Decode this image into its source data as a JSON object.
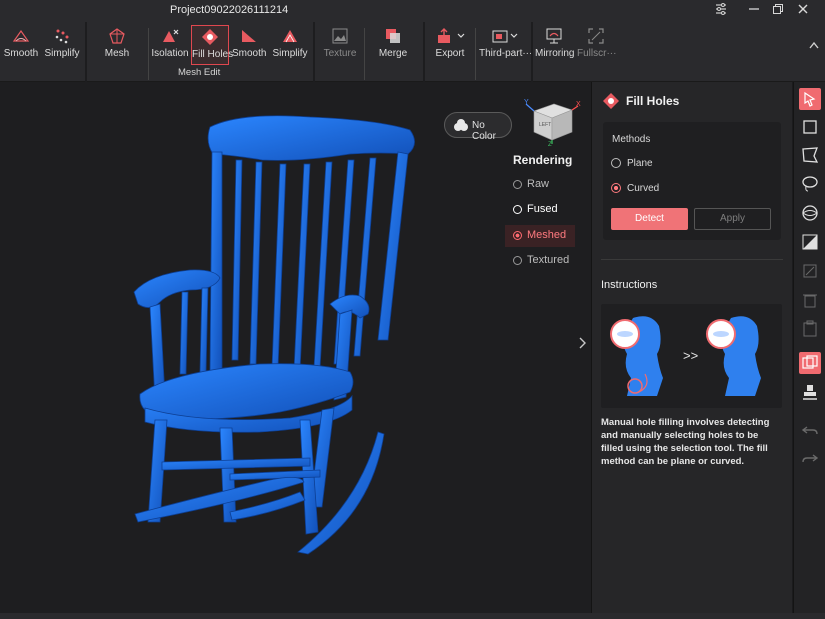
{
  "window": {
    "title": "Project09022026111214",
    "controls": [
      "settings-icon",
      "minimize-icon",
      "restore-icon",
      "close-icon"
    ]
  },
  "toolbar": {
    "tools": [
      {
        "id": "smooth-left",
        "label": "Smooth",
        "icon": "smooth-icon"
      },
      {
        "id": "simplify-left",
        "label": "Simplify",
        "icon": "simplify-icon"
      },
      {
        "id": "mesh",
        "label": "Mesh",
        "icon": "mesh-icon"
      },
      {
        "id": "isolation",
        "label": "Isolation",
        "icon": "isolation-icon"
      },
      {
        "id": "fill-holes",
        "label": "Fill Holes",
        "icon": "fill-holes-icon",
        "active": true
      },
      {
        "id": "smooth",
        "label": "Smooth",
        "icon": "smooth-icon"
      },
      {
        "id": "simplify",
        "label": "Simplify",
        "icon": "simplify-icon"
      },
      {
        "id": "texture",
        "label": "Texture",
        "icon": "texture-icon",
        "disabled": true
      },
      {
        "id": "merge",
        "label": "Merge",
        "icon": "merge-icon"
      },
      {
        "id": "export",
        "label": "Export",
        "icon": "export-icon"
      },
      {
        "id": "third-party",
        "label": "Third-part···",
        "icon": "third-party-icon"
      },
      {
        "id": "mirroring",
        "label": "Mirroring",
        "icon": "mirroring-icon"
      },
      {
        "id": "fullscreen",
        "label": "Fullscr···",
        "icon": "fullscreen-icon",
        "disabled": true
      }
    ],
    "group_label": "Mesh Edit"
  },
  "viewport": {
    "color_toggle_label": "No Color",
    "axis_labels": {
      "x": "X",
      "y": "Y",
      "z": "Z"
    },
    "view_cube_face": "LEFT",
    "rendering": {
      "title": "Rendering",
      "options": [
        {
          "label": "Raw",
          "state": "off"
        },
        {
          "label": "Fused",
          "state": "selected"
        },
        {
          "label": "Meshed",
          "state": "active"
        },
        {
          "label": "Textured",
          "state": "off"
        }
      ]
    },
    "model_color": "#1f6fe0"
  },
  "panel": {
    "title": "Fill Holes",
    "methods": {
      "header": "Methods",
      "options": [
        {
          "label": "Plane",
          "selected": false
        },
        {
          "label": "Curved",
          "selected": true
        }
      ],
      "detect_label": "Detect",
      "apply_label": "Apply"
    },
    "instructions": {
      "title": "Instructions",
      "arrow": ">>",
      "text": "Manual hole filling involves detecting and manually selecting holes to be filled using the selection tool. The fill method can be plane or curved."
    }
  },
  "side_tools": [
    {
      "name": "select-pointer-icon",
      "active": true
    },
    {
      "name": "rectangle-select-icon"
    },
    {
      "name": "polygon-select-icon"
    },
    {
      "name": "lasso-select-icon"
    },
    {
      "name": "connected-select-icon"
    },
    {
      "name": "invert-select-icon"
    },
    {
      "name": "clear-select-icon",
      "disabled": true
    },
    {
      "name": "delete-icon",
      "disabled": true
    },
    {
      "name": "paste-icon",
      "disabled": true
    },
    {
      "name": "layers-icon",
      "active": true
    },
    {
      "name": "stamp-icon"
    },
    {
      "name": "undo-icon",
      "disabled": true
    },
    {
      "name": "redo-icon",
      "disabled": true
    }
  ],
  "colors": {
    "accent": "#f06b70",
    "background": "#1e1e20",
    "panel": "#262628"
  }
}
